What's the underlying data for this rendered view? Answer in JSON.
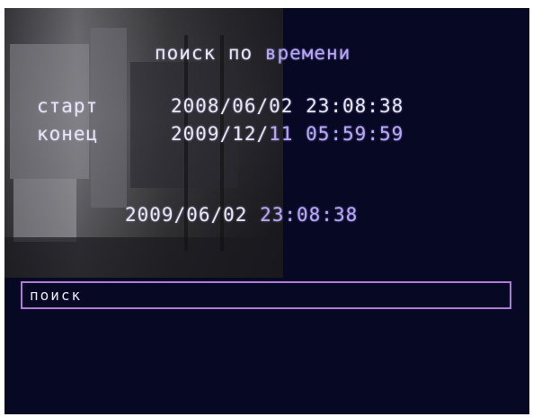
{
  "osd": {
    "title_part1": "поиск по",
    "title_part2": "времени",
    "start": {
      "label": "старт",
      "date": "2008/06/02",
      "time": "23:08:38"
    },
    "end": {
      "label": "конец",
      "date": "2009/12/",
      "date_day": "11",
      "time": "05:59:59"
    },
    "current": {
      "date": "2009/06/02",
      "time": "23:08:38"
    },
    "search_button_label": "поиск"
  },
  "colors": {
    "background": "#070824",
    "text": "#e8e6f2",
    "accent": "#b9a6ff",
    "selection_border": "#b07bd8"
  }
}
